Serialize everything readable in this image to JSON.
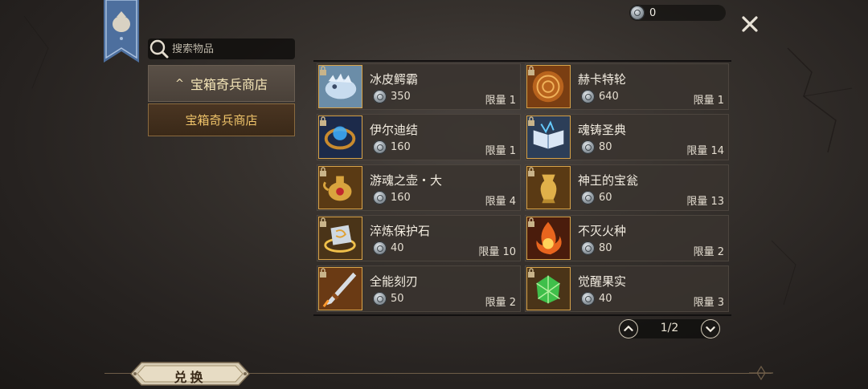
{
  "currency": {
    "value": "0"
  },
  "search": {
    "placeholder": "搜索物品"
  },
  "categories": {
    "header": "宝箱奇兵商店",
    "items": [
      {
        "label": "宝箱奇兵商店"
      }
    ]
  },
  "items": [
    {
      "name": "冰皮鳄霸",
      "price": "350",
      "limit": "限量 1",
      "icon": "ice-croc-icon"
    },
    {
      "name": "赫卡特轮",
      "price": "640",
      "limit": "限量 1",
      "icon": "hecate-wheel-icon"
    },
    {
      "name": "伊尔迪结",
      "price": "160",
      "limit": "限量 1",
      "icon": "knot-ring-icon"
    },
    {
      "name": "魂铸圣典",
      "price": "80",
      "limit": "限量 14",
      "icon": "tome-icon"
    },
    {
      "name": "游魂之壶・大",
      "price": "160",
      "limit": "限量 4",
      "icon": "soul-pot-icon"
    },
    {
      "name": "神王的宝瓮",
      "price": "60",
      "limit": "限量 13",
      "icon": "urn-icon"
    },
    {
      "name": "淬炼保护石",
      "price": "40",
      "limit": "限量 10",
      "icon": "protect-stone-icon"
    },
    {
      "name": "不灭火种",
      "price": "80",
      "limit": "限量 2",
      "icon": "fire-seed-icon"
    },
    {
      "name": "全能刻刃",
      "price": "50",
      "limit": "限量 2",
      "icon": "blade-icon"
    },
    {
      "name": "觉醒果实",
      "price": "40",
      "limit": "限量 3",
      "icon": "awaken-fruit-icon"
    }
  ],
  "pager": {
    "text": "1/2"
  },
  "exchange": {
    "label": "兑换"
  },
  "colors": {
    "accent_gold": "#f0c46a",
    "panel": "#3a342f"
  }
}
